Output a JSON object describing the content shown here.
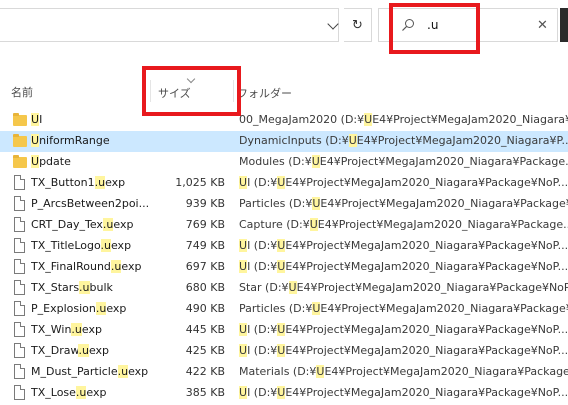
{
  "search": {
    "query": ".u"
  },
  "columns": {
    "name": "名前",
    "size": "サイズ",
    "folder": "フォルダー"
  },
  "rows": [
    {
      "type": "folder",
      "selected": false,
      "name": [
        "",
        "U",
        "I"
      ],
      "size": "",
      "folder": [
        "00_MegaJam2020 (D:¥",
        "U",
        "E4¥Project¥MegaJam2020_Niagara¥Package¥NoPr..."
      ]
    },
    {
      "type": "folder",
      "selected": true,
      "name": [
        "",
        "U",
        "niformRange"
      ],
      "size": "",
      "folder": [
        "DynamicInputs (D:¥",
        "U",
        "E4¥Project¥MegaJam2020_Niagara¥P..."
      ]
    },
    {
      "type": "folder",
      "selected": false,
      "name": [
        "",
        "U",
        "pdate"
      ],
      "size": "",
      "folder": [
        "Modules (D:¥",
        "U",
        "E4¥Project¥MegaJam2020_Niagara¥Package..."
      ]
    },
    {
      "type": "file",
      "selected": false,
      "name": [
        "TX_Button1",
        ".u",
        "exp"
      ],
      "size": "1,025 KB",
      "folder": [
        "",
        "U",
        "I (D:¥",
        "U",
        "E4¥Project¥MegaJam2020_Niagara¥Package¥NoP..."
      ]
    },
    {
      "type": "file",
      "selected": false,
      "name": [
        "P_ArcsBetween2poi...",
        "",
        ""
      ],
      "size": "939 KB",
      "folder": [
        "Particles (D:¥",
        "U",
        "E4¥Project¥MegaJam2020_Niagara¥Package¥..."
      ]
    },
    {
      "type": "file",
      "selected": false,
      "name": [
        "CRT_Day_Tex",
        ".u",
        "exp"
      ],
      "size": "769 KB",
      "folder": [
        "Capture (D:¥",
        "U",
        "E4¥Project¥MegaJam2020_Niagara¥Package..."
      ]
    },
    {
      "type": "file",
      "selected": false,
      "name": [
        "TX_TitleLogo",
        ".u",
        "exp"
      ],
      "size": "749 KB",
      "folder": [
        "",
        "U",
        "I (D:¥",
        "U",
        "E4¥Project¥MegaJam2020_Niagara¥Package¥NoP..."
      ]
    },
    {
      "type": "file",
      "selected": false,
      "name": [
        "TX_FinalRound",
        ".u",
        "exp"
      ],
      "size": "697 KB",
      "folder": [
        "",
        "U",
        "I (D:¥",
        "U",
        "E4¥Project¥MegaJam2020_Niagara¥Package¥NoP..."
      ]
    },
    {
      "type": "file",
      "selected": false,
      "name": [
        "TX_Stars",
        ".u",
        "bulk"
      ],
      "size": "680 KB",
      "folder": [
        "Star (D:¥",
        "U",
        "E4¥Project¥MegaJam2020_Niagara¥Package¥NoPr..."
      ]
    },
    {
      "type": "file",
      "selected": false,
      "name": [
        "P_Explosion",
        ".u",
        "exp"
      ],
      "size": "490 KB",
      "folder": [
        "Particles (D:¥",
        "U",
        "E4¥Project¥MegaJam2020_Niagara¥Package¥..."
      ]
    },
    {
      "type": "file",
      "selected": false,
      "name": [
        "TX_Win",
        ".u",
        "exp"
      ],
      "size": "445 KB",
      "folder": [
        "",
        "U",
        "I (D:¥",
        "U",
        "E4¥Project¥MegaJam2020_Niagara¥Package¥NoP..."
      ]
    },
    {
      "type": "file",
      "selected": false,
      "name": [
        "TX_Draw",
        ".u",
        "exp"
      ],
      "size": "425 KB",
      "folder": [
        "",
        "U",
        "I (D:¥",
        "U",
        "E4¥Project¥MegaJam2020_Niagara¥Package¥NoP..."
      ]
    },
    {
      "type": "file",
      "selected": false,
      "name": [
        "M_Dust_Particle",
        ".u",
        "exp"
      ],
      "size": "422 KB",
      "folder": [
        "Materials (D:¥",
        "U",
        "E4¥Project¥MegaJam2020_Niagara¥Package..."
      ]
    },
    {
      "type": "file",
      "selected": false,
      "name": [
        "TX_Lose",
        ".u",
        "exp"
      ],
      "size": "385 KB",
      "folder": [
        "",
        "U",
        "I (D:¥",
        "U",
        "E4¥Project¥MegaJam2020_Niagara¥Package¥NoP..."
      ]
    }
  ]
}
